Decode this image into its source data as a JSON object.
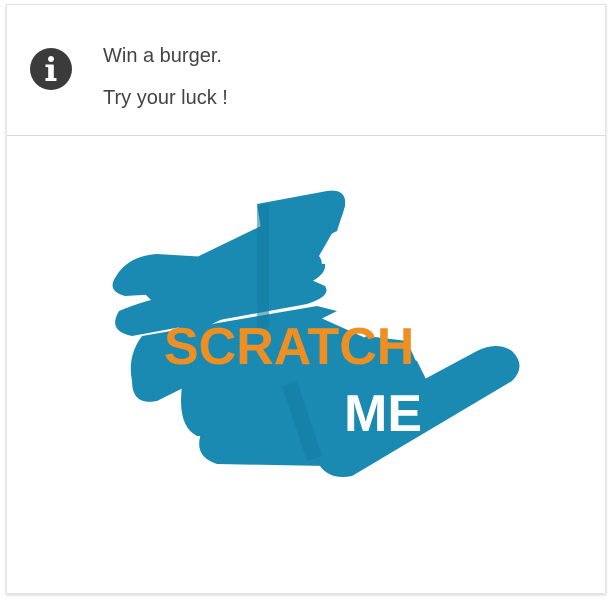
{
  "notification": {
    "icon": "info-icon",
    "line1": "Win a burger.",
    "line2": "Try your luck !"
  },
  "scratch_card": {
    "word1": "SCRATCH",
    "word2": "ME",
    "colors": {
      "blob": "#1a8ab3",
      "word1": "#ef8f22",
      "word2": "#ffffff"
    }
  }
}
